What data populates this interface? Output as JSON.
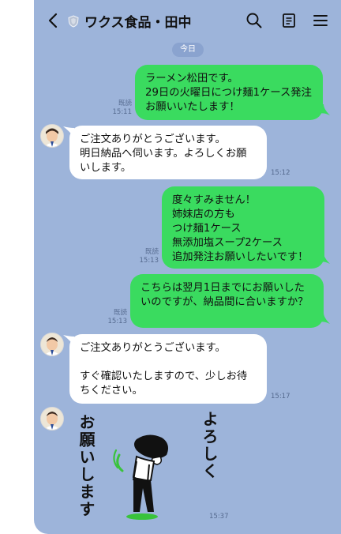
{
  "header": {
    "title": "ワクス食品・田中"
  },
  "date_chip": "今日",
  "messages": [
    {
      "side": "out",
      "text": "ラーメン松田です。\n29日の火曜日につけ麺1ケース発注お願いいたします！",
      "read": "既読",
      "time": "15:11"
    },
    {
      "side": "in",
      "text": "ご注文ありがとうございます。\n明日納品へ伺います。よろしくお願いします。",
      "time": "15:12"
    },
    {
      "side": "out",
      "text": "度々すみません！\n姉妹店の方も\nつけ麺1ケース\n無添加塩スープ2ケース\n追加発注お願いしたいです！",
      "read": "既読",
      "time": "15:13"
    },
    {
      "side": "out",
      "text": "こちらは翌月1日までにお願いしたいのですが、納品間に合いますか？",
      "read": "既読",
      "time": "15:13"
    },
    {
      "side": "in",
      "text": "ご注文ありがとうございます。\n\nすぐ確認いたしますので、少しお待ちください。",
      "time": "15:17"
    }
  ],
  "sticker": {
    "left_text": "お願いします",
    "right_text": "よろしく",
    "time": "15:37"
  },
  "colors": {
    "background": "#9db4da",
    "outgoing": "#3adb5f",
    "incoming": "#ffffff"
  }
}
